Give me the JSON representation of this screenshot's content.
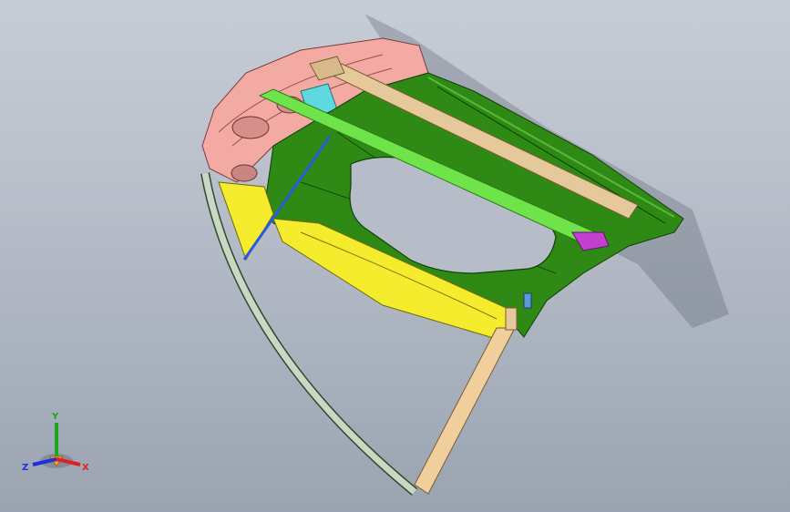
{
  "view": {
    "background_top": "#c7cdd6",
    "background_bottom": "#9aa3b1",
    "model": "hood-door-assembly",
    "parts": [
      {
        "name": "outer-panel-pink",
        "color": "#f0a9a4"
      },
      {
        "name": "inner-panel-green",
        "color": "#2f8a12"
      },
      {
        "name": "reinforcement-yellow",
        "color": "#f4ec2c"
      },
      {
        "name": "cross-member-light-green",
        "color": "#6fe34a"
      },
      {
        "name": "rail-tan",
        "color": "#e6c99a"
      },
      {
        "name": "bracket-cyan",
        "color": "#5fd8e0"
      },
      {
        "name": "frame-edge",
        "color": "#c9d8c4"
      }
    ]
  },
  "triad": {
    "x_label": "X",
    "y_label": "Y",
    "z_label": "Z",
    "x_color": "#e02020",
    "y_color": "#18a818",
    "z_color": "#2030d8"
  }
}
